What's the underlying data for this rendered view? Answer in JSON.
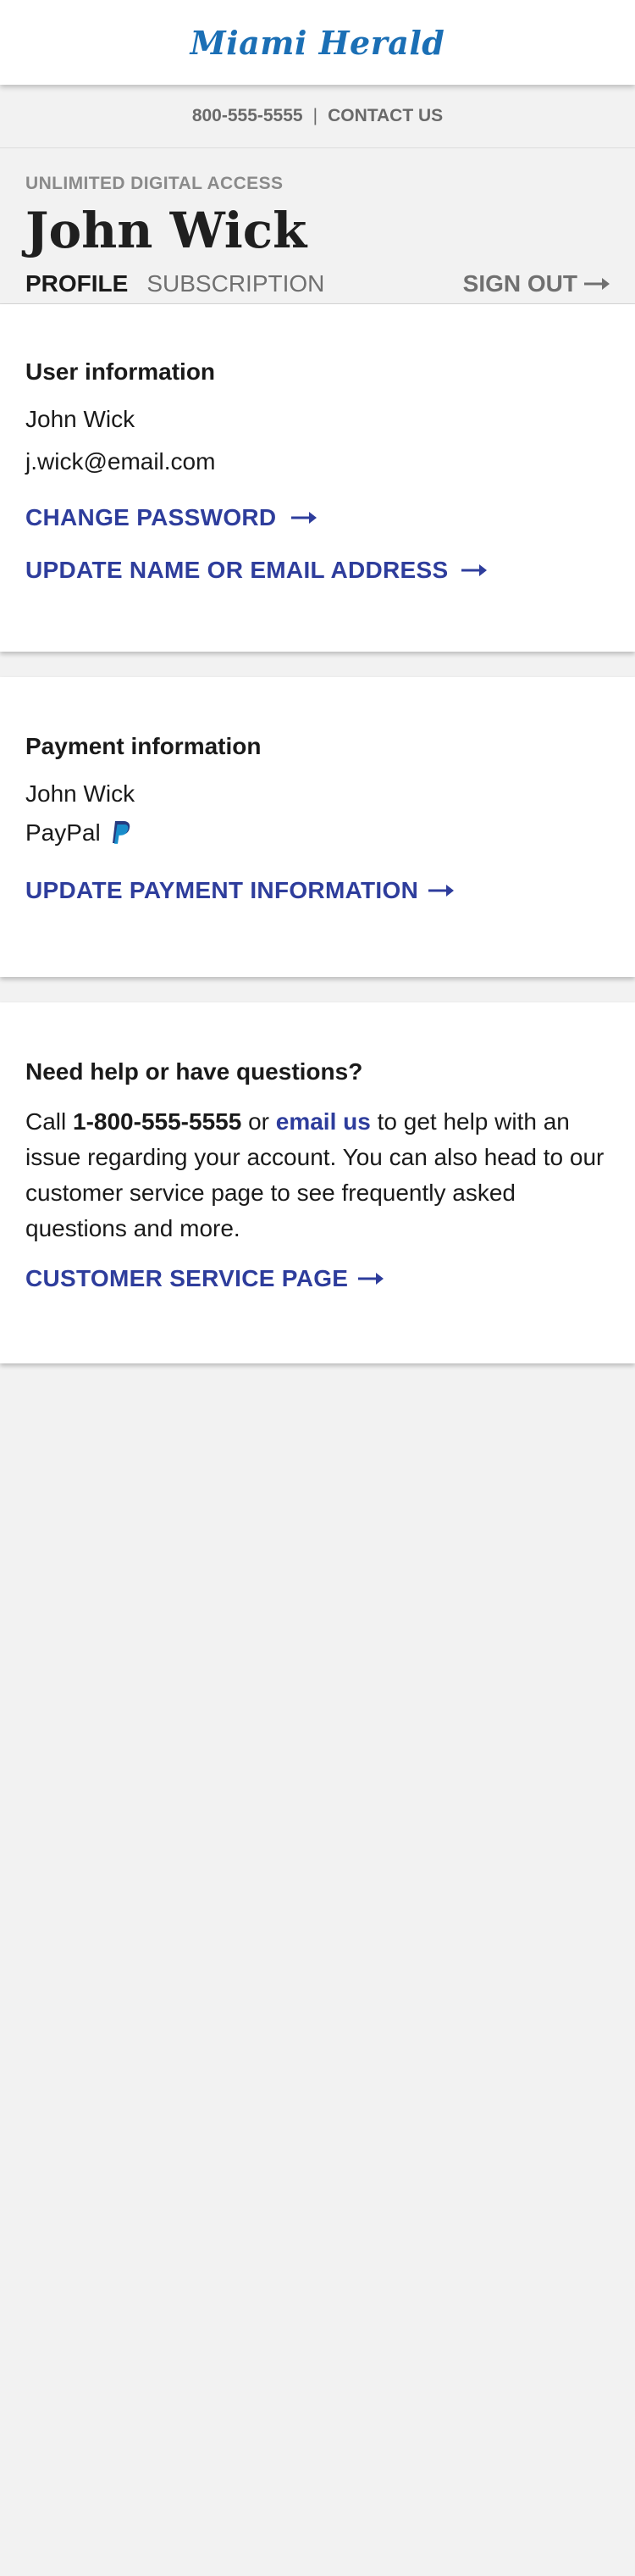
{
  "header": {
    "logo": "Miami Herald",
    "phone": "800-555-5555",
    "separator": "|",
    "contact_label": "CONTACT US"
  },
  "account": {
    "eyebrow": "UNLIMITED DIGITAL ACCESS",
    "name": "John Wick",
    "tabs": [
      {
        "label": "PROFILE",
        "active": true
      },
      {
        "label": "SUBSCRIPTION",
        "active": false
      }
    ],
    "sign_out_label": "SIGN OUT"
  },
  "user_info": {
    "title": "User information",
    "name": "John Wick",
    "email": "j.wick@email.com",
    "change_password_label": "CHANGE PASSWORD",
    "update_name_email_label": "UPDATE NAME OR EMAIL ADDRESS"
  },
  "payment_info": {
    "title": "Payment information",
    "name": "John Wick",
    "method": "PayPal",
    "method_icon": "paypal-icon",
    "update_payment_label": "UPDATE PAYMENT INFORMATION"
  },
  "help": {
    "title": "Need help or have questions?",
    "text_call": "Call",
    "phone": "1-800-555-5555",
    "text_or": "or",
    "email_link": "email us",
    "text_rest": "to get help with an issue regarding your account. You can also head to our customer service page to see frequently asked questions and more.",
    "customer_service_label": "CUSTOMER SERVICE PAGE"
  },
  "colors": {
    "brand_blue": "#1b6fb5",
    "link_blue": "#2e3d9c",
    "page_background": "#f2f2f2"
  }
}
